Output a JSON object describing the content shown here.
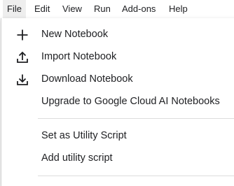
{
  "menubar": {
    "items": [
      {
        "label": "File"
      },
      {
        "label": "Edit"
      },
      {
        "label": "View"
      },
      {
        "label": "Run"
      },
      {
        "label": "Add-ons"
      },
      {
        "label": "Help"
      }
    ]
  },
  "file_menu": {
    "items": [
      {
        "label": "New Notebook",
        "icon": "plus-icon"
      },
      {
        "label": "Import Notebook",
        "icon": "upload-icon"
      },
      {
        "label": "Download Notebook",
        "icon": "download-icon"
      },
      {
        "label": "Upgrade to Google Cloud AI Notebooks",
        "icon": ""
      },
      {
        "label": "Set as Utility Script",
        "icon": ""
      },
      {
        "label": "Add utility script",
        "icon": ""
      }
    ]
  }
}
